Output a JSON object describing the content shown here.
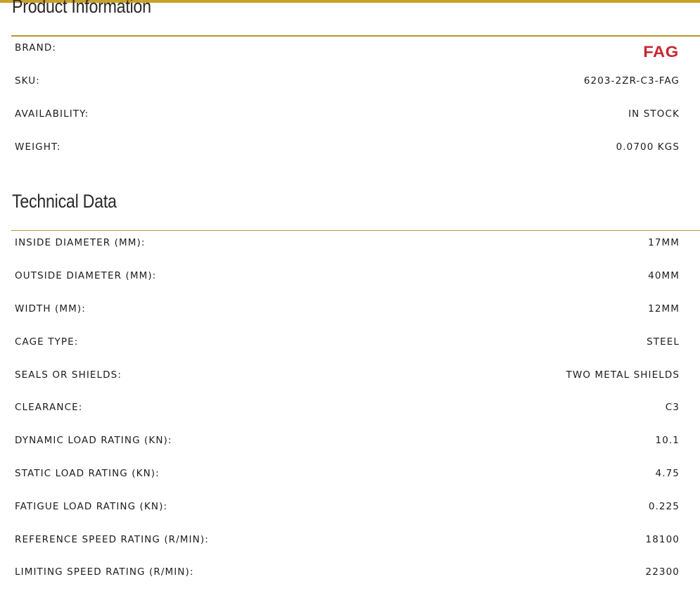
{
  "product_information": {
    "title": "Product Information",
    "brand": {
      "label": "BRAND:",
      "logo_text": "FAG",
      "logo_color": "#c8262f"
    },
    "rows": [
      {
        "label": "SKU:",
        "value": "6203-2ZR-C3-FAG"
      },
      {
        "label": "AVAILABILITY:",
        "value": "IN STOCK"
      },
      {
        "label": "WEIGHT:",
        "value": "0.0700 KGS"
      }
    ]
  },
  "technical_data": {
    "title": "Technical Data",
    "rows": [
      {
        "label": "INSIDE DIAMETER (MM):",
        "value": "17MM"
      },
      {
        "label": "OUTSIDE DIAMETER (MM):",
        "value": "40MM"
      },
      {
        "label": "WIDTH (MM):",
        "value": "12MM"
      },
      {
        "label": "CAGE TYPE:",
        "value": "STEEL"
      },
      {
        "label": "SEALS OR SHIELDS:",
        "value": "TWO METAL SHIELDS"
      },
      {
        "label": "CLEARANCE:",
        "value": "C3"
      },
      {
        "label": "DYNAMIC LOAD RATING (KN):",
        "value": "10.1"
      },
      {
        "label": "STATIC LOAD RATING (KN):",
        "value": "4.75"
      },
      {
        "label": "FATIGUE LOAD RATING (KN):",
        "value": "0.225"
      },
      {
        "label": "REFERENCE SPEED RATING (R/MIN):",
        "value": "18100"
      },
      {
        "label": "LIMITING SPEED RATING (R/MIN):",
        "value": "22300"
      }
    ]
  },
  "colors": {
    "accent": "#c9a227",
    "rule": "#b8952e",
    "text": "#1c1c1c"
  }
}
